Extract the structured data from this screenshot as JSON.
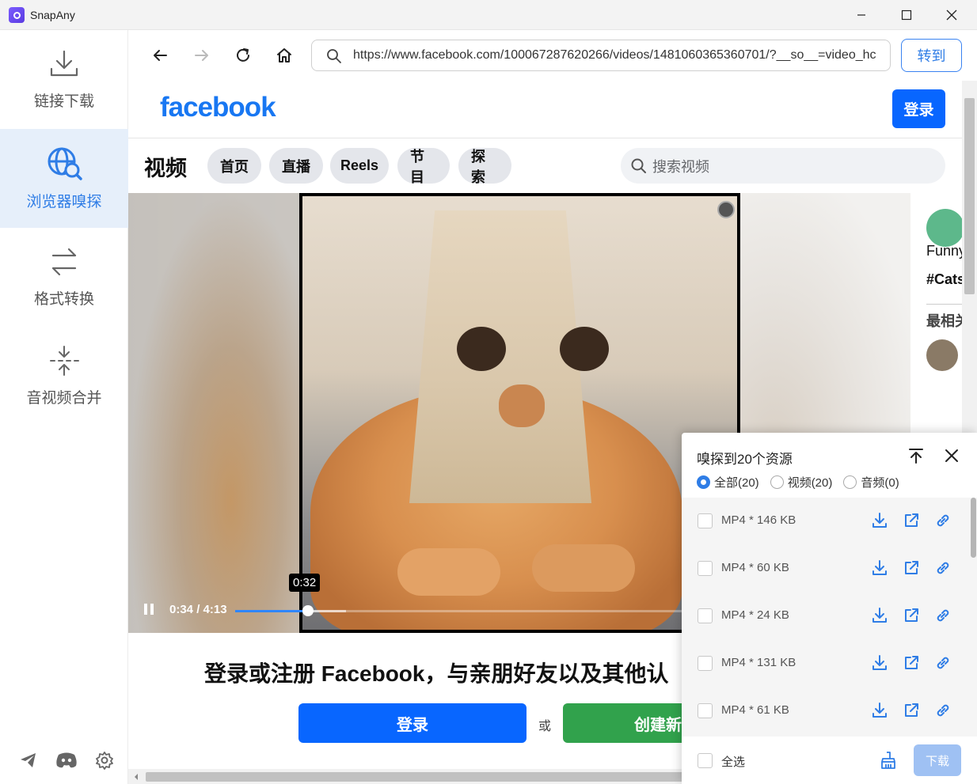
{
  "app": {
    "title": "SnapAny"
  },
  "sidebar": {
    "items": [
      {
        "label": "链接下载",
        "icon": "download-icon"
      },
      {
        "label": "浏览器嗅探",
        "icon": "globe-search-icon"
      },
      {
        "label": "格式转换",
        "icon": "arrows-swap-icon"
      },
      {
        "label": "音视频合并",
        "icon": "merge-icon"
      }
    ],
    "active_index": 1,
    "bottom_icons": [
      "telegram-icon",
      "discord-icon",
      "settings-icon"
    ]
  },
  "browser": {
    "url": "https://www.facebook.com/100067287620266/videos/1481060365360701/?__so__=video_hc",
    "go_label": "转到"
  },
  "facebook": {
    "logo": "facebook",
    "login_top": "登录",
    "section_title": "视频",
    "tabs": [
      "首页",
      "直播",
      "Reels",
      "节目",
      "探索"
    ],
    "search_placeholder": "搜索视频",
    "video": {
      "time": "0:34 / 4:13",
      "hover_time": "0:32",
      "progress": 0.131,
      "buffered": 0.2
    },
    "side": {
      "caption1": "Funny",
      "caption2": "#Cats",
      "related": "最相关"
    },
    "signup_title": "登录或注册 Facebook，与亲朋好友以及其他认",
    "login_btn": "登录",
    "or": "或",
    "create_btn": "创建新"
  },
  "sniff": {
    "title": "嗅探到20个资源",
    "filters": [
      {
        "label": "全部(20)",
        "checked": true
      },
      {
        "label": "视频(20)",
        "checked": false
      },
      {
        "label": "音频(0)",
        "checked": false
      }
    ],
    "items": [
      {
        "name": "MP4 * 146 KB"
      },
      {
        "name": "MP4 * 60 KB"
      },
      {
        "name": "MP4 * 24 KB"
      },
      {
        "name": "MP4 * 131 KB"
      },
      {
        "name": "MP4 * 61 KB"
      }
    ],
    "select_all": "全选",
    "download": "下载",
    "accent": "#2f7de6"
  }
}
